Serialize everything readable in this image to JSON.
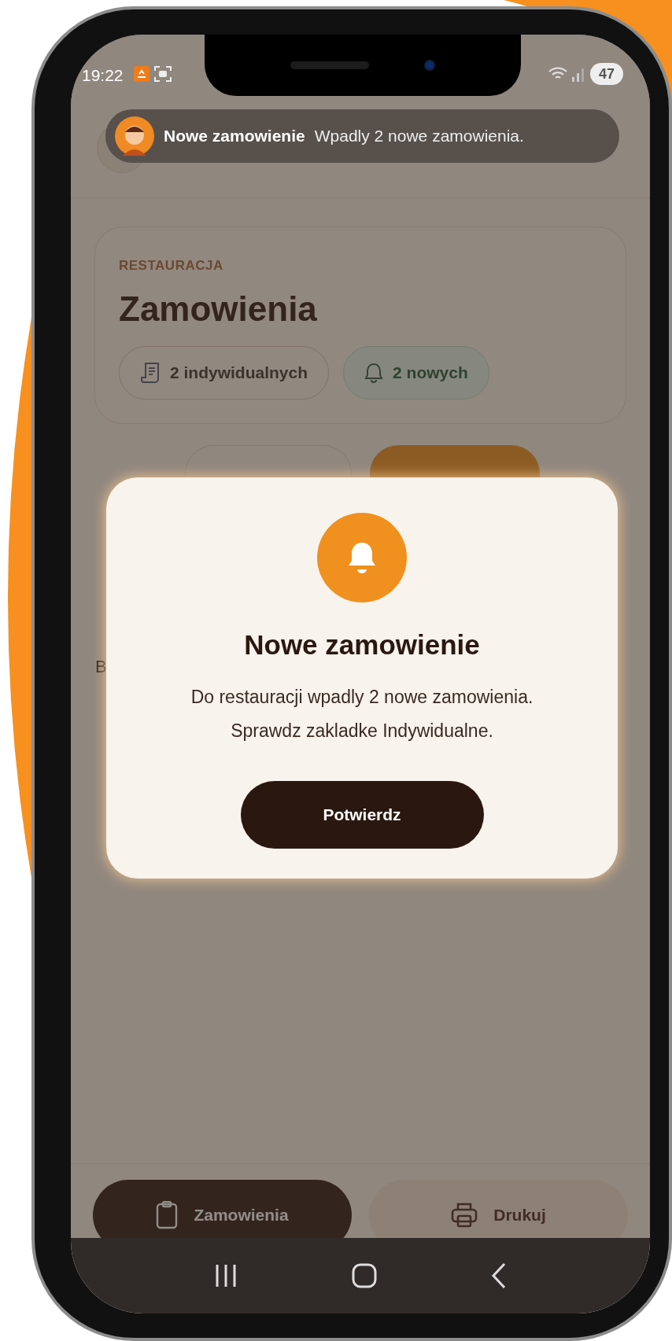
{
  "status_bar": {
    "time": "19:22",
    "battery": "47"
  },
  "notification": {
    "title": "Nowe zamowienie",
    "message": "Wpadly 2 nowe zamowienia."
  },
  "card": {
    "eyebrow": "RESTAURACJA",
    "title": "Zamowienia",
    "chips": [
      {
        "kind": "orders",
        "label": "2 indywidualnych"
      },
      {
        "kind": "new",
        "label": "2 nowych"
      }
    ]
  },
  "segments": [
    {
      "selected": false
    },
    {
      "selected": true
    }
  ],
  "partial_text": "B",
  "dialog": {
    "title": "Nowe zamowienie",
    "message": "Do restauracji wpadly 2 nowe zamowienia. Sprawdz zakladke Indywidualne.",
    "button": "Potwierdz"
  },
  "bottom_nav": [
    {
      "kind": "orders",
      "label": "Zamowienia",
      "selected": true
    },
    {
      "kind": "print",
      "label": "Drukuj",
      "selected": false
    }
  ]
}
